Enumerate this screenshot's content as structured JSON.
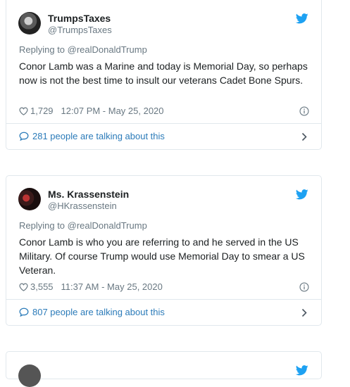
{
  "tweets": [
    {
      "name": "TrumpsTaxes",
      "handle": "@TrumpsTaxes",
      "reply_to": "Replying to @realDonaldTrump",
      "text": "Conor Lamb was a Marine and today is Memorial Day, so perhaps now is not the best time to insult our veterans Cadet Bone Spurs.",
      "likes": "1,729",
      "timestamp": "12:07 PM - May 25, 2020",
      "talking": "281 people are talking about this"
    },
    {
      "name": "Ms. Krassenstein",
      "handle": "@HKrassenstein",
      "reply_to": "Replying to @realDonaldTrump",
      "text": "Conor Lamb is who you are referring to and he served in the US Military.  Of course Trump would use Memorial Day to smear a US Veteran.",
      "likes": "3,555",
      "timestamp": "11:37 AM - May 25, 2020",
      "talking": "807 people are talking about this"
    }
  ],
  "colors": {
    "twitter_blue": "#1da1f2",
    "link_blue": "#2b7bb9",
    "text": "#1c2022",
    "muted": "#697882",
    "border": "#e1e8ed"
  },
  "icons": [
    "twitter-bird-icon",
    "heart-icon",
    "info-icon",
    "speech-bubble-icon",
    "chevron-right-icon"
  ]
}
